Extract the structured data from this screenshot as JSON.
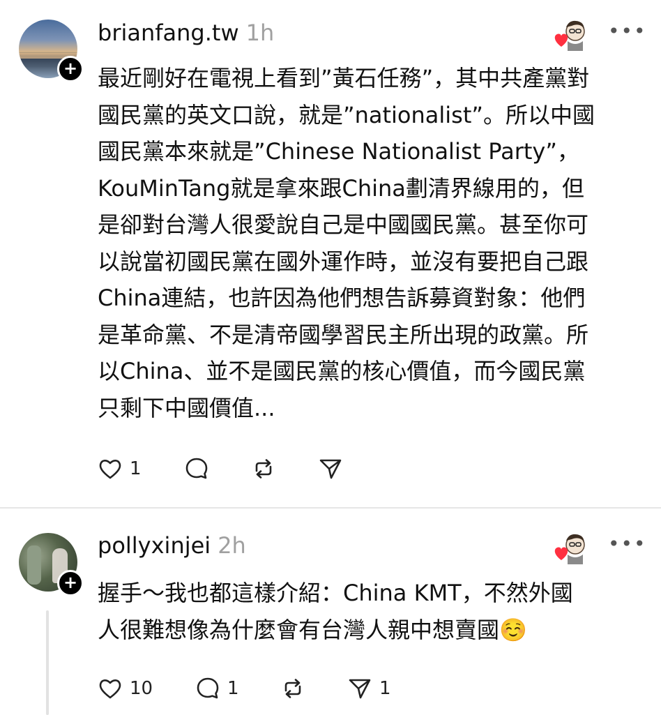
{
  "posts": [
    {
      "username": "brianfang.tw",
      "time": "1h",
      "lines": [
        "最近剛好在電視上看到”黃石任務”，其中共產黨對",
        "國民黨的英文口說，就是”nationalist”。所以中國",
        "國民黨本來就是”Chinese Nationalist Party”，",
        "KouMinTang就是拿來跟China劃清界線用的，但",
        "是卻對台灣人很愛說自己是中國國民黨。甚至你可",
        "以說當初國民黨在國外運作時，並沒有要把自己跟",
        "China連結，也許因為他們想告訴募資對象：他們",
        "是革命黨、不是清帝國學習民主所出現的政黨。所",
        "以China、並不是國民黨的核心價值，而今國民黨",
        "只剩下中國價值..."
      ],
      "actions": {
        "like_count": "1",
        "reply_count": "",
        "repost_count": "",
        "share_count": ""
      }
    },
    {
      "username": "pollyxinjei",
      "time": "2h",
      "lines": [
        "握手～我也都這樣介紹：China KMT，不然外國",
        "人很難想像為什麼會有台灣人親中想賣國☺️"
      ],
      "actions": {
        "like_count": "10",
        "reply_count": "1",
        "repost_count": "",
        "share_count": "1"
      }
    }
  ],
  "icons": {
    "more": "more-icon",
    "like": "heart-icon",
    "reply": "comment-icon",
    "repost": "repost-icon",
    "share": "send-icon",
    "follow": "plus-icon",
    "liked_by": "author-liked-icon"
  },
  "colors": {
    "text": "#111111",
    "muted": "#a0a0a0",
    "heart": "#ff3040",
    "divider": "#e6e6e6"
  },
  "ui": {
    "more_glyph": "•••",
    "follow_glyph": "+"
  }
}
